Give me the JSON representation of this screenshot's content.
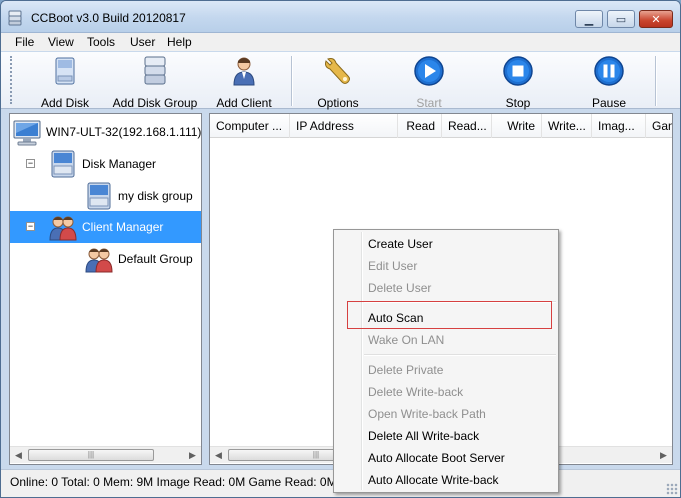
{
  "window": {
    "title": "CCBoot v3.0 Build 20120817",
    "min_icon": "minimize-icon",
    "max_icon": "maximize-icon",
    "close_icon": "close-icon"
  },
  "menubar": {
    "items": [
      "File",
      "View",
      "Tools",
      "User",
      "Help"
    ]
  },
  "toolbar": {
    "buttons": [
      {
        "label": "Add Disk",
        "icon": "disk-icon",
        "enabled": true
      },
      {
        "label": "Add Disk Group",
        "icon": "disk-group-icon",
        "enabled": true
      },
      {
        "label": "Add Client",
        "icon": "client-icon",
        "enabled": true
      },
      {
        "label": "Options",
        "icon": "wrench-icon",
        "enabled": true
      },
      {
        "label": "Start",
        "icon": "play-icon",
        "enabled": false
      },
      {
        "label": "Stop",
        "icon": "stop-icon",
        "enabled": true
      },
      {
        "label": "Pause",
        "icon": "pause-icon",
        "enabled": true
      }
    ]
  },
  "tree": {
    "root": {
      "label": "WIN7-ULT-32(192.168.1.111)",
      "icon": "computer-icon"
    },
    "disk_manager": {
      "label": "Disk Manager",
      "icon": "disk-manager-icon"
    },
    "disk_group": {
      "label": "my disk group",
      "icon": "disk-group-icon"
    },
    "client_manager": {
      "label": "Client Manager",
      "icon": "users-icon",
      "selected": true
    },
    "default_group": {
      "label": "Default Group",
      "icon": "users-icon"
    }
  },
  "list": {
    "columns": [
      "Computer ...",
      "IP Address",
      "Read",
      "Read...",
      "Write",
      "Write...",
      "Imag...",
      "Gam"
    ]
  },
  "status": {
    "text": "Online: 0 Total: 0 Mem: 9M Image Read: 0M Game Read: 0M I"
  },
  "context_menu": {
    "items": [
      {
        "label": "Create User",
        "enabled": true
      },
      {
        "label": "Edit User",
        "enabled": false
      },
      {
        "label": "Delete User",
        "enabled": false
      },
      {
        "label": "Auto Scan",
        "enabled": true
      },
      {
        "label": "Wake On LAN",
        "enabled": false
      },
      {
        "label": "Delete Private",
        "enabled": false
      },
      {
        "label": "Delete Write-back",
        "enabled": false
      },
      {
        "label": "Open Write-back Path",
        "enabled": false
      },
      {
        "label": "Delete All Write-back",
        "enabled": true
      },
      {
        "label": "Auto Allocate Boot Server",
        "enabled": true
      },
      {
        "label": "Auto Allocate Write-back",
        "enabled": true
      }
    ]
  },
  "colors": {
    "selection": "#3399ff",
    "highlight_box": "#d64040",
    "play_blue": "#1e6fd0"
  }
}
